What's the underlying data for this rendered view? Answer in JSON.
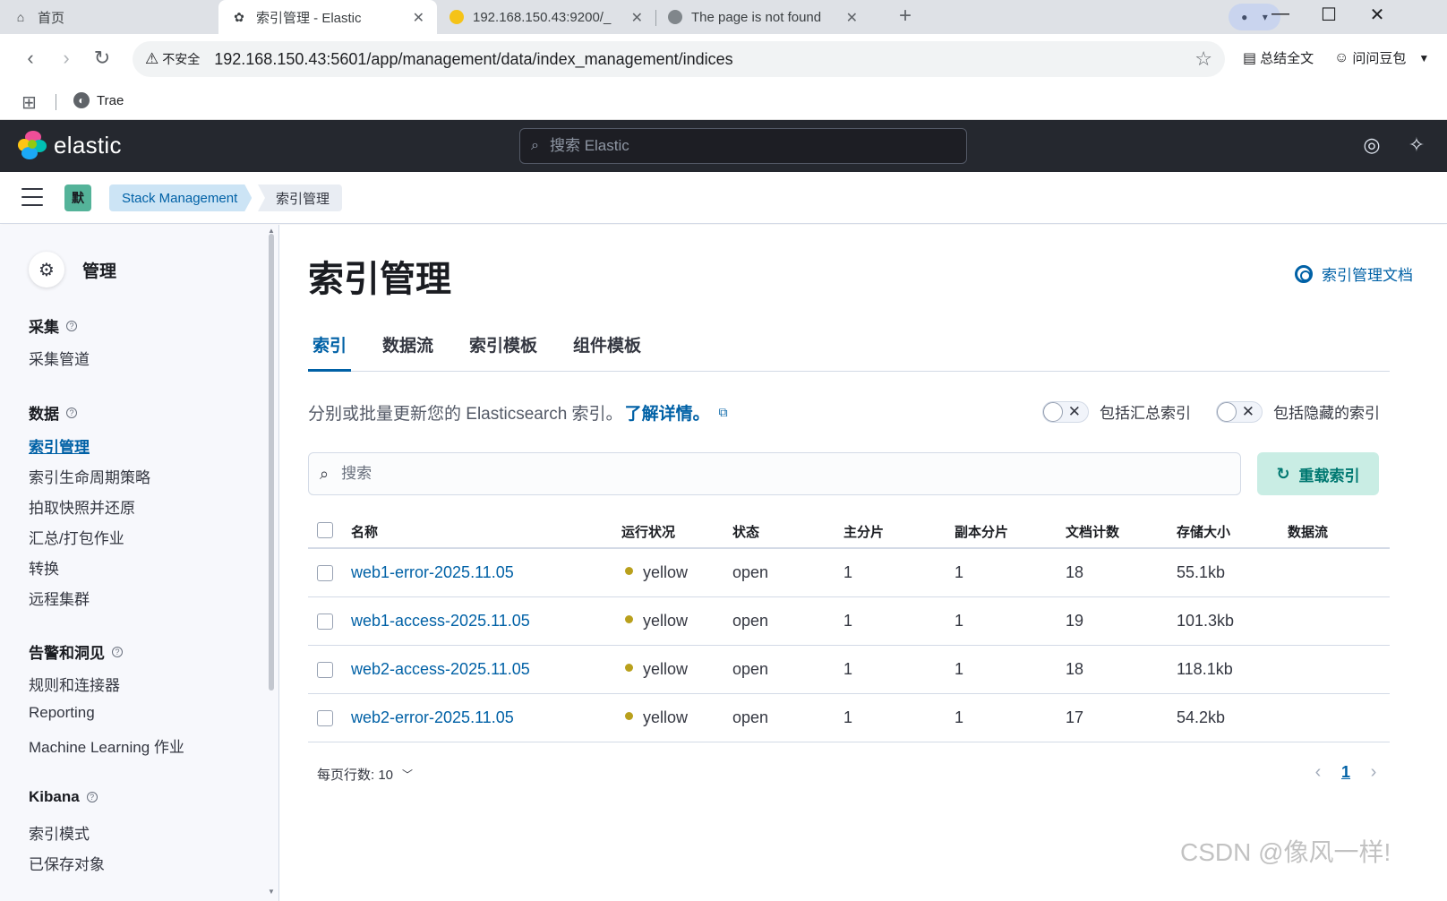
{
  "browser": {
    "tabs": [
      {
        "title": "首页",
        "icon": "home-icon"
      },
      {
        "title": "索引管理 - Elastic",
        "icon": "elastic-icon"
      },
      {
        "title": "192.168.150.43:9200/_",
        "icon": "elasticsearch-icon"
      },
      {
        "title": "The page is not found",
        "icon": "globe-icon"
      }
    ],
    "insecure_label": "不安全",
    "url": "192.168.150.43:5601/app/management/data/index_management/indices",
    "ext_summary": "总结全文",
    "ext_doubao": "问问豆包",
    "bookmark_trae": "Trae"
  },
  "kibana": {
    "logo_text": "elastic",
    "search_placeholder": "搜索 Elastic",
    "space_badge": "默",
    "breadcrumbs": [
      "Stack Management",
      "索引管理"
    ]
  },
  "sidebar": {
    "title": "管理",
    "groups": [
      {
        "label": "采集",
        "items": [
          "采集管道"
        ]
      },
      {
        "label": "数据",
        "items": [
          "索引管理",
          "索引生命周期策略",
          "拍取快照并还原",
          "汇总/打包作业",
          "转换",
          "远程集群"
        ]
      },
      {
        "label": "告警和洞见",
        "items": [
          "规则和连接器",
          "Reporting",
          "Machine Learning 作业"
        ]
      },
      {
        "label": "Kibana",
        "items": [
          "索引模式",
          "已保存对象"
        ]
      }
    ],
    "active_item": "索引管理"
  },
  "main": {
    "title": "索引管理",
    "doc_link": "索引管理文档",
    "tabs": [
      "索引",
      "数据流",
      "索引模板",
      "组件模板"
    ],
    "description": "分别或批量更新您的 Elasticsearch 索引。",
    "learn_more": "了解详情。",
    "toggle_rollup": "包括汇总索引",
    "toggle_hidden": "包括隐藏的索引",
    "search_placeholder": "搜索",
    "reload_button": "重载索引",
    "table": {
      "headers": [
        "名称",
        "运行状况",
        "状态",
        "主分片",
        "副本分片",
        "文档计数",
        "存储大小",
        "数据流"
      ],
      "rows": [
        {
          "name": "web1-error-2025.11.05",
          "health": "yellow",
          "status": "open",
          "primary": "1",
          "replica": "1",
          "docs": "18",
          "size": "55.1kb",
          "stream": ""
        },
        {
          "name": "web1-access-2025.11.05",
          "health": "yellow",
          "status": "open",
          "primary": "1",
          "replica": "1",
          "docs": "19",
          "size": "101.3kb",
          "stream": ""
        },
        {
          "name": "web2-access-2025.11.05",
          "health": "yellow",
          "status": "open",
          "primary": "1",
          "replica": "1",
          "docs": "18",
          "size": "118.1kb",
          "stream": ""
        },
        {
          "name": "web2-error-2025.11.05",
          "health": "yellow",
          "status": "open",
          "primary": "1",
          "replica": "1",
          "docs": "17",
          "size": "54.2kb",
          "stream": ""
        }
      ]
    },
    "rows_per_page": "每页行数: 10",
    "current_page": "1"
  },
  "colors": {
    "health_yellow": "#b9a01c",
    "accent": "#0061a6",
    "header_bg": "#25282f"
  },
  "watermark": "CSDN @像风一样!"
}
